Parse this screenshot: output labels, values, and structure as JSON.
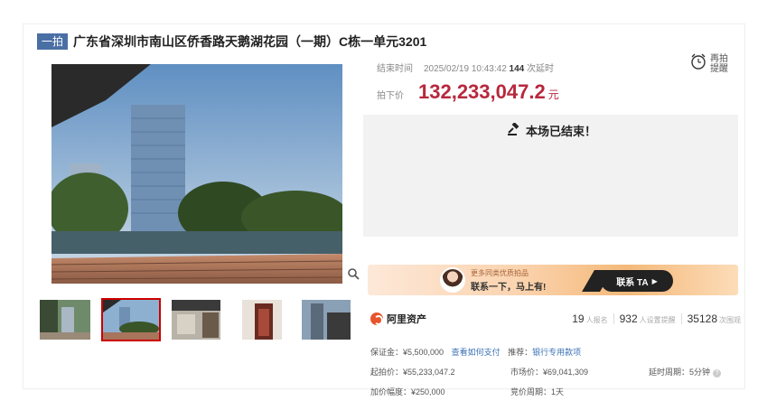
{
  "listing": {
    "tag": "一拍",
    "title": "广东省深圳市南山区侨香路天鹅湖花园（一期）C栋一单元3201"
  },
  "auction": {
    "end_time_label": "结束时间",
    "end_time": "2025/02/19 10:43:42",
    "delay_count": "144",
    "delay_label": "次延时",
    "remind_label": "再拍提醒",
    "price_label": "拍下价",
    "price": "132,233,047.2",
    "price_unit": "元",
    "ended_text": "本场已结束！"
  },
  "banner": {
    "small_text": "更多同类优质拍品",
    "main_text": "联系一下，马上有!",
    "button_label": "联系 TA"
  },
  "stats": {
    "brand": "阿里资产",
    "signups": "19",
    "signups_label": "人报名",
    "reminders": "932",
    "reminders_label": "人设置提醒",
    "views": "35128",
    "views_label": "次围观"
  },
  "details": {
    "deposit": "保证金：¥5,500,000",
    "deposit_link": "查看如何支付",
    "recommend_label": "推荐：",
    "recommend_link": "银行专用款项",
    "start_price": "起拍价：¥55,233,047.2",
    "market_price": "市场价：¥69,041,309",
    "delay_period": "延时周期：5分钟",
    "increment": "加价幅度：¥250,000",
    "bid_period": "竞价周期：1天"
  },
  "icons": {
    "zoom": "magnifier-icon",
    "remind": "alarm-clock-icon",
    "auction": "gavel-icon",
    "help": "question-icon"
  },
  "colors": {
    "price": "#b8283c",
    "tag": "#4a6fa5",
    "link": "#3b72b6",
    "thumb_active": "#cc0000"
  }
}
